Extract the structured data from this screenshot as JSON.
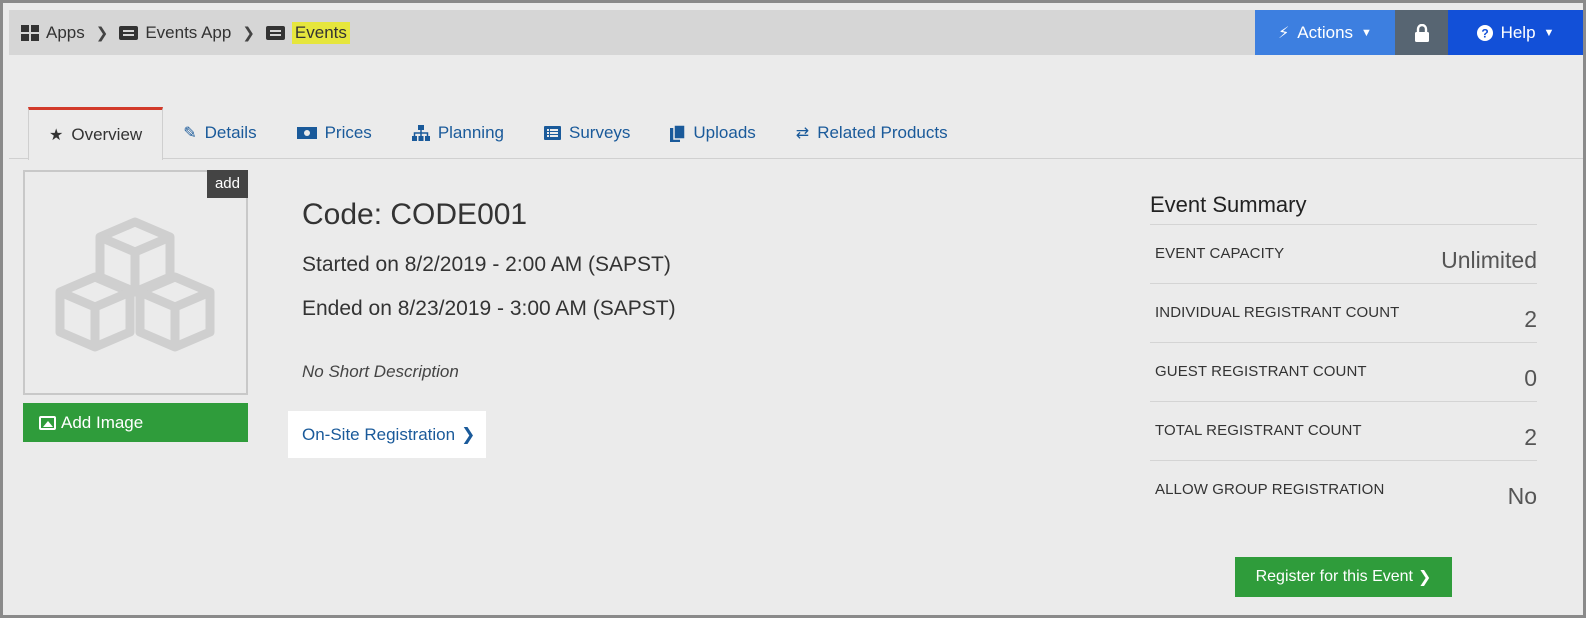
{
  "breadcrumb": {
    "items": [
      {
        "label": "Apps",
        "icon": "grid-icon"
      },
      {
        "label": "Events App",
        "icon": "ticket-icon"
      },
      {
        "label": "Events",
        "icon": "ticket-icon"
      }
    ]
  },
  "topbar": {
    "actions_label": "Actions",
    "help_label": "Help",
    "lock_icon": "lock-icon"
  },
  "tabs": [
    {
      "label": "Overview",
      "icon": "star-icon",
      "active": true
    },
    {
      "label": "Details",
      "icon": "edit-icon"
    },
    {
      "label": "Prices",
      "icon": "money-icon"
    },
    {
      "label": "Planning",
      "icon": "sitemap-icon"
    },
    {
      "label": "Surveys",
      "icon": "list-icon"
    },
    {
      "label": "Uploads",
      "icon": "files-icon"
    },
    {
      "label": "Related Products",
      "icon": "retweet-icon"
    }
  ],
  "image": {
    "add_tag": "add",
    "add_image_label": "Add Image"
  },
  "event": {
    "code": "Code: CODE001",
    "started": "Started on 8/2/2019 - 2:00 AM (SAPST)",
    "ended": "Ended on 8/23/2019 - 3:00 AM (SAPST)",
    "short_description": "No Short Description",
    "onsite_label": "On-Site Registration"
  },
  "summary": {
    "title": "Event Summary",
    "rows": [
      {
        "label": "EVENT CAPACITY",
        "value": "Unlimited"
      },
      {
        "label": "INDIVIDUAL REGISTRANT COUNT",
        "value": "2"
      },
      {
        "label": "GUEST REGISTRANT COUNT",
        "value": "0"
      },
      {
        "label": "TOTAL REGISTRANT COUNT",
        "value": "2"
      },
      {
        "label": "ALLOW GROUP REGISTRATION",
        "value": "No"
      }
    ],
    "register_label": "Register for this Event"
  },
  "colors": {
    "actions": "#3d7fe0",
    "lock": "#576572",
    "help": "#1250d8",
    "green": "#2f9c3b",
    "link": "#1a5a9a",
    "active_tab_border": "#d23a2a",
    "highlight": "#e6e63d"
  }
}
